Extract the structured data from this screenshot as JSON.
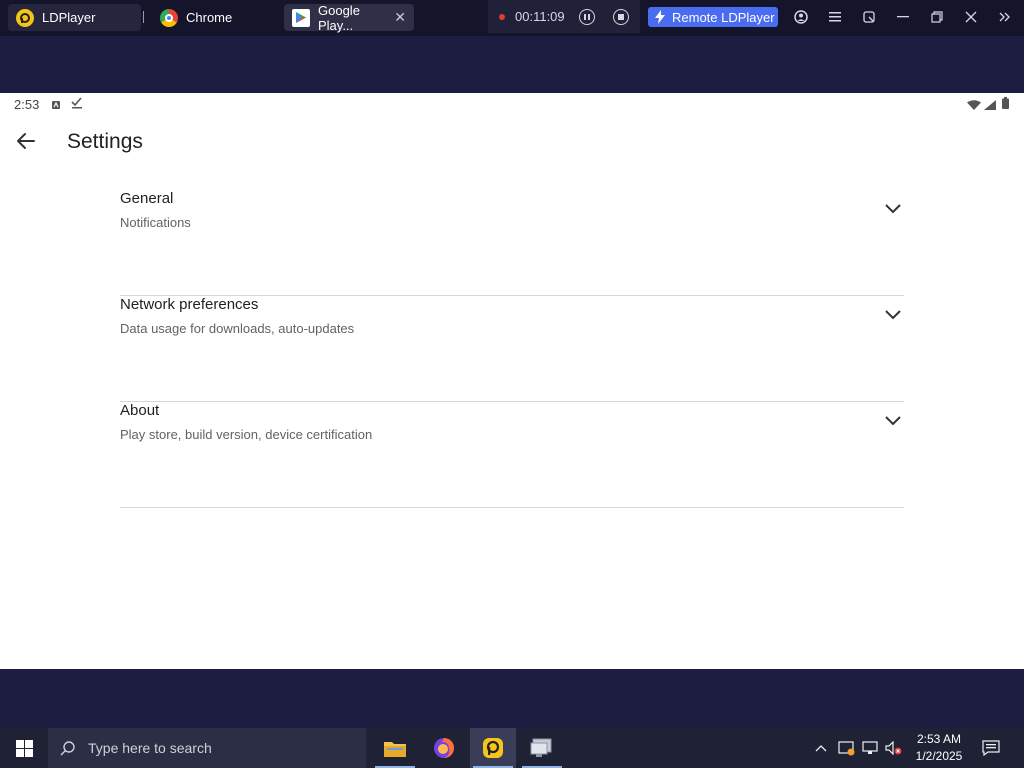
{
  "emulator": {
    "tabs": [
      {
        "label": "LDPlayer",
        "icon": "ldplayer-icon"
      },
      {
        "label": "Chrome",
        "icon": "chrome-icon"
      },
      {
        "label": "Google Play...",
        "icon": "google-play-icon"
      }
    ],
    "recording_time": "00:11:09",
    "remote_label": "Remote LDPlayer"
  },
  "android": {
    "status_time": "2:53",
    "title": "Settings",
    "items": [
      {
        "title": "General",
        "subtitle": "Notifications"
      },
      {
        "title": "Network preferences",
        "subtitle": "Data usage for downloads, auto-updates"
      },
      {
        "title": "About",
        "subtitle": "Play store, build version, device certification"
      }
    ]
  },
  "taskbar": {
    "search_placeholder": "Type here to search",
    "time": "2:53 AM",
    "date": "1/2/2025"
  },
  "colors": {
    "emulator_bg": "#1c1d40",
    "remote_button": "#4a6cf0",
    "divider": "#d6d6d6"
  }
}
